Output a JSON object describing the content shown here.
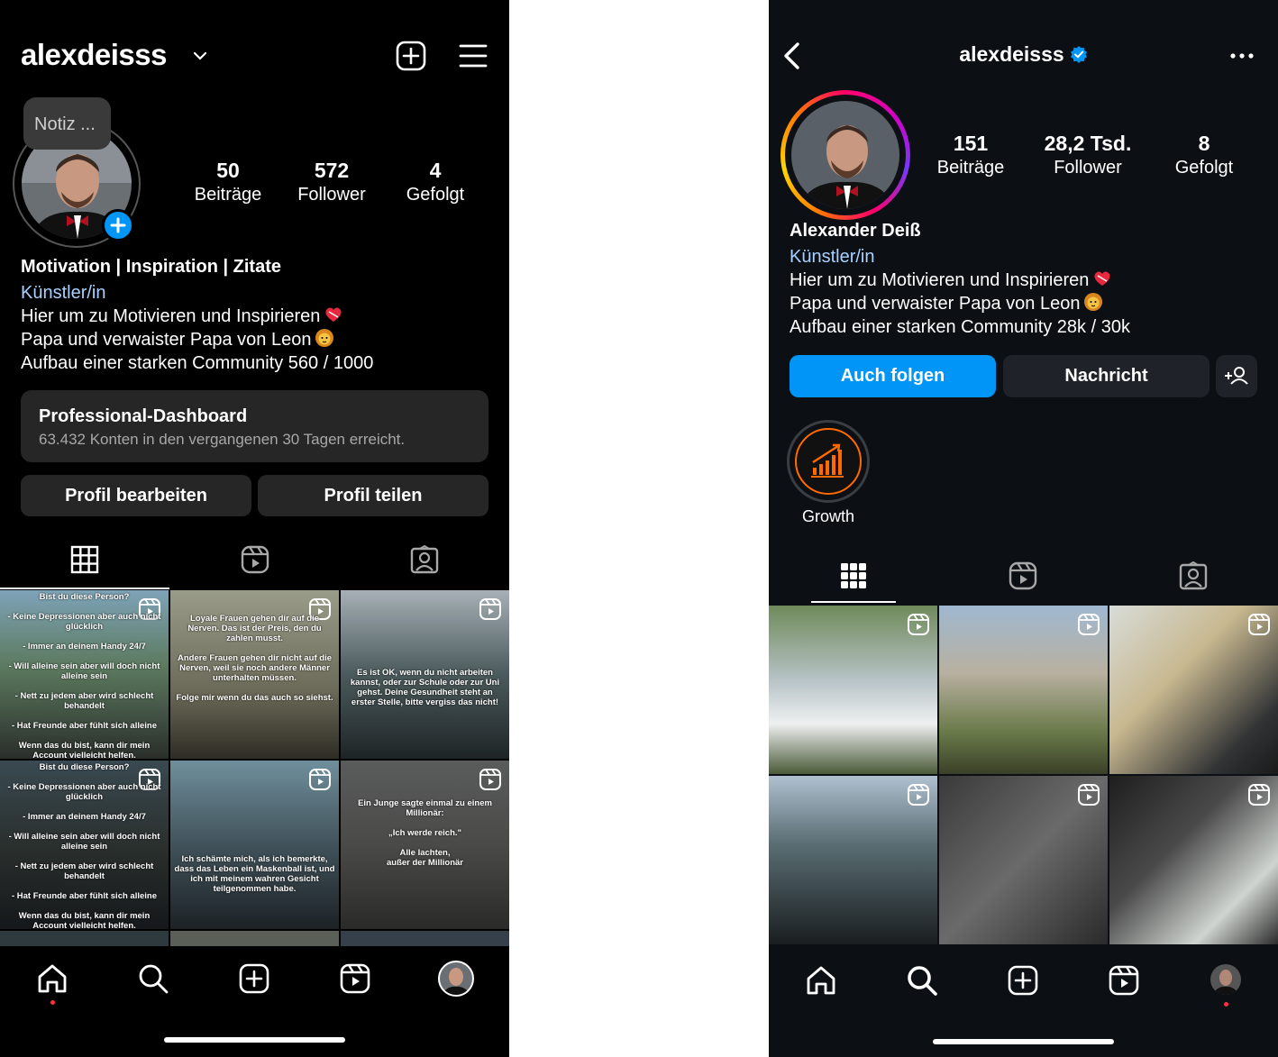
{
  "left": {
    "username": "alexdeisss",
    "note": "Notiz ...",
    "stats": [
      {
        "num": "50",
        "label": "Beiträge"
      },
      {
        "num": "572",
        "label": "Follower"
      },
      {
        "num": "4",
        "label": "Gefolgt"
      }
    ],
    "bio": {
      "title": "Motivation | Inspiration | Zitate",
      "category": "Künstler/in",
      "lines": [
        "Hier um zu Motivieren und Inspirieren",
        "Papa und verwaister Papa von Leon",
        "Aufbau einer starken Community 560 / 1000"
      ]
    },
    "dashboard": {
      "title": "Professional-Dashboard",
      "subtitle": "63.432 Konten in den vergangenen 30 Tagen erreicht."
    },
    "buttons": {
      "edit": "Profil bearbeiten",
      "share": "Profil teilen"
    },
    "posts": [
      {
        "text": "Bist du diese Person?\n\n- Keine Depressionen aber auch nicht glücklich\n\n- Immer an deinem Handy 24/7\n\n- Will alleine sein aber will doch nicht alleine sein\n\n- Nett zu jedem aber wird schlecht behandelt\n\n- Hat Freunde aber fühlt sich alleine\n\nWenn das du bist, kann dir mein Account vielleicht helfen."
      },
      {
        "text": "Loyale Frauen gehen dir auf die Nerven. Das ist der Preis, den du zahlen musst.\n\nAndere Frauen gehen dir nicht auf die Nerven, weil sie noch andere Männer unterhalten müssen.\n\nFolge mir wenn du das auch so siehst."
      },
      {
        "text": "Es ist OK, wenn du nicht arbeiten kannst, oder zur Schule oder zur Uni gehst. Deine Gesundheit steht an erster Stelle, bitte vergiss das nicht!"
      },
      {
        "text": "Bist du diese Person?\n\n- Keine Depressionen aber auch nicht glücklich\n\n- Immer an deinem Handy 24/7\n\n- Will alleine sein aber will doch nicht alleine sein\n\n- Nett zu jedem aber wird schlecht behandelt\n\n- Hat Freunde aber fühlt sich alleine\n\nWenn das du bist, kann dir mein Account vielleicht helfen."
      },
      {
        "text": "Ich schämte mich, als ich bemerkte, dass das Leben ein Maskenball ist, und ich mit meinem wahren Gesicht teilgenommen habe."
      },
      {
        "text": "Ein Junge sagte einmal zu einem Millionär:\n\n„Ich werde reich.\"\n\nAlle lachten,\naußer der Millionär"
      }
    ]
  },
  "right": {
    "username": "alexdeisss",
    "stats": [
      {
        "num": "151",
        "label": "Beiträge"
      },
      {
        "num": "28,2 Tsd.",
        "label": "Follower"
      },
      {
        "num": "8",
        "label": "Gefolgt"
      }
    ],
    "bio": {
      "name": "Alexander Deiß",
      "category": "Künstler/in",
      "lines": [
        "Hier um zu Motivieren und Inspirieren",
        "Papa und verwaister Papa von Leon",
        "Aufbau einer starken Community 28k / 30k"
      ]
    },
    "buttons": {
      "follow": "Auch folgen",
      "message": "Nachricht"
    },
    "highlight": "Growth"
  },
  "colors": {
    "accent": "#0095f6",
    "bg_left": "#000000",
    "bg_right": "#0c1014",
    "notification": "#ff3040"
  },
  "icons": [
    "chevron-down-icon",
    "new-post-icon",
    "hamburger-menu-icon",
    "grid-icon",
    "reels-icon",
    "tagged-icon",
    "home-icon",
    "search-icon",
    "create-icon",
    "back-icon",
    "verified-icon",
    "more-icon",
    "add-person-icon"
  ]
}
